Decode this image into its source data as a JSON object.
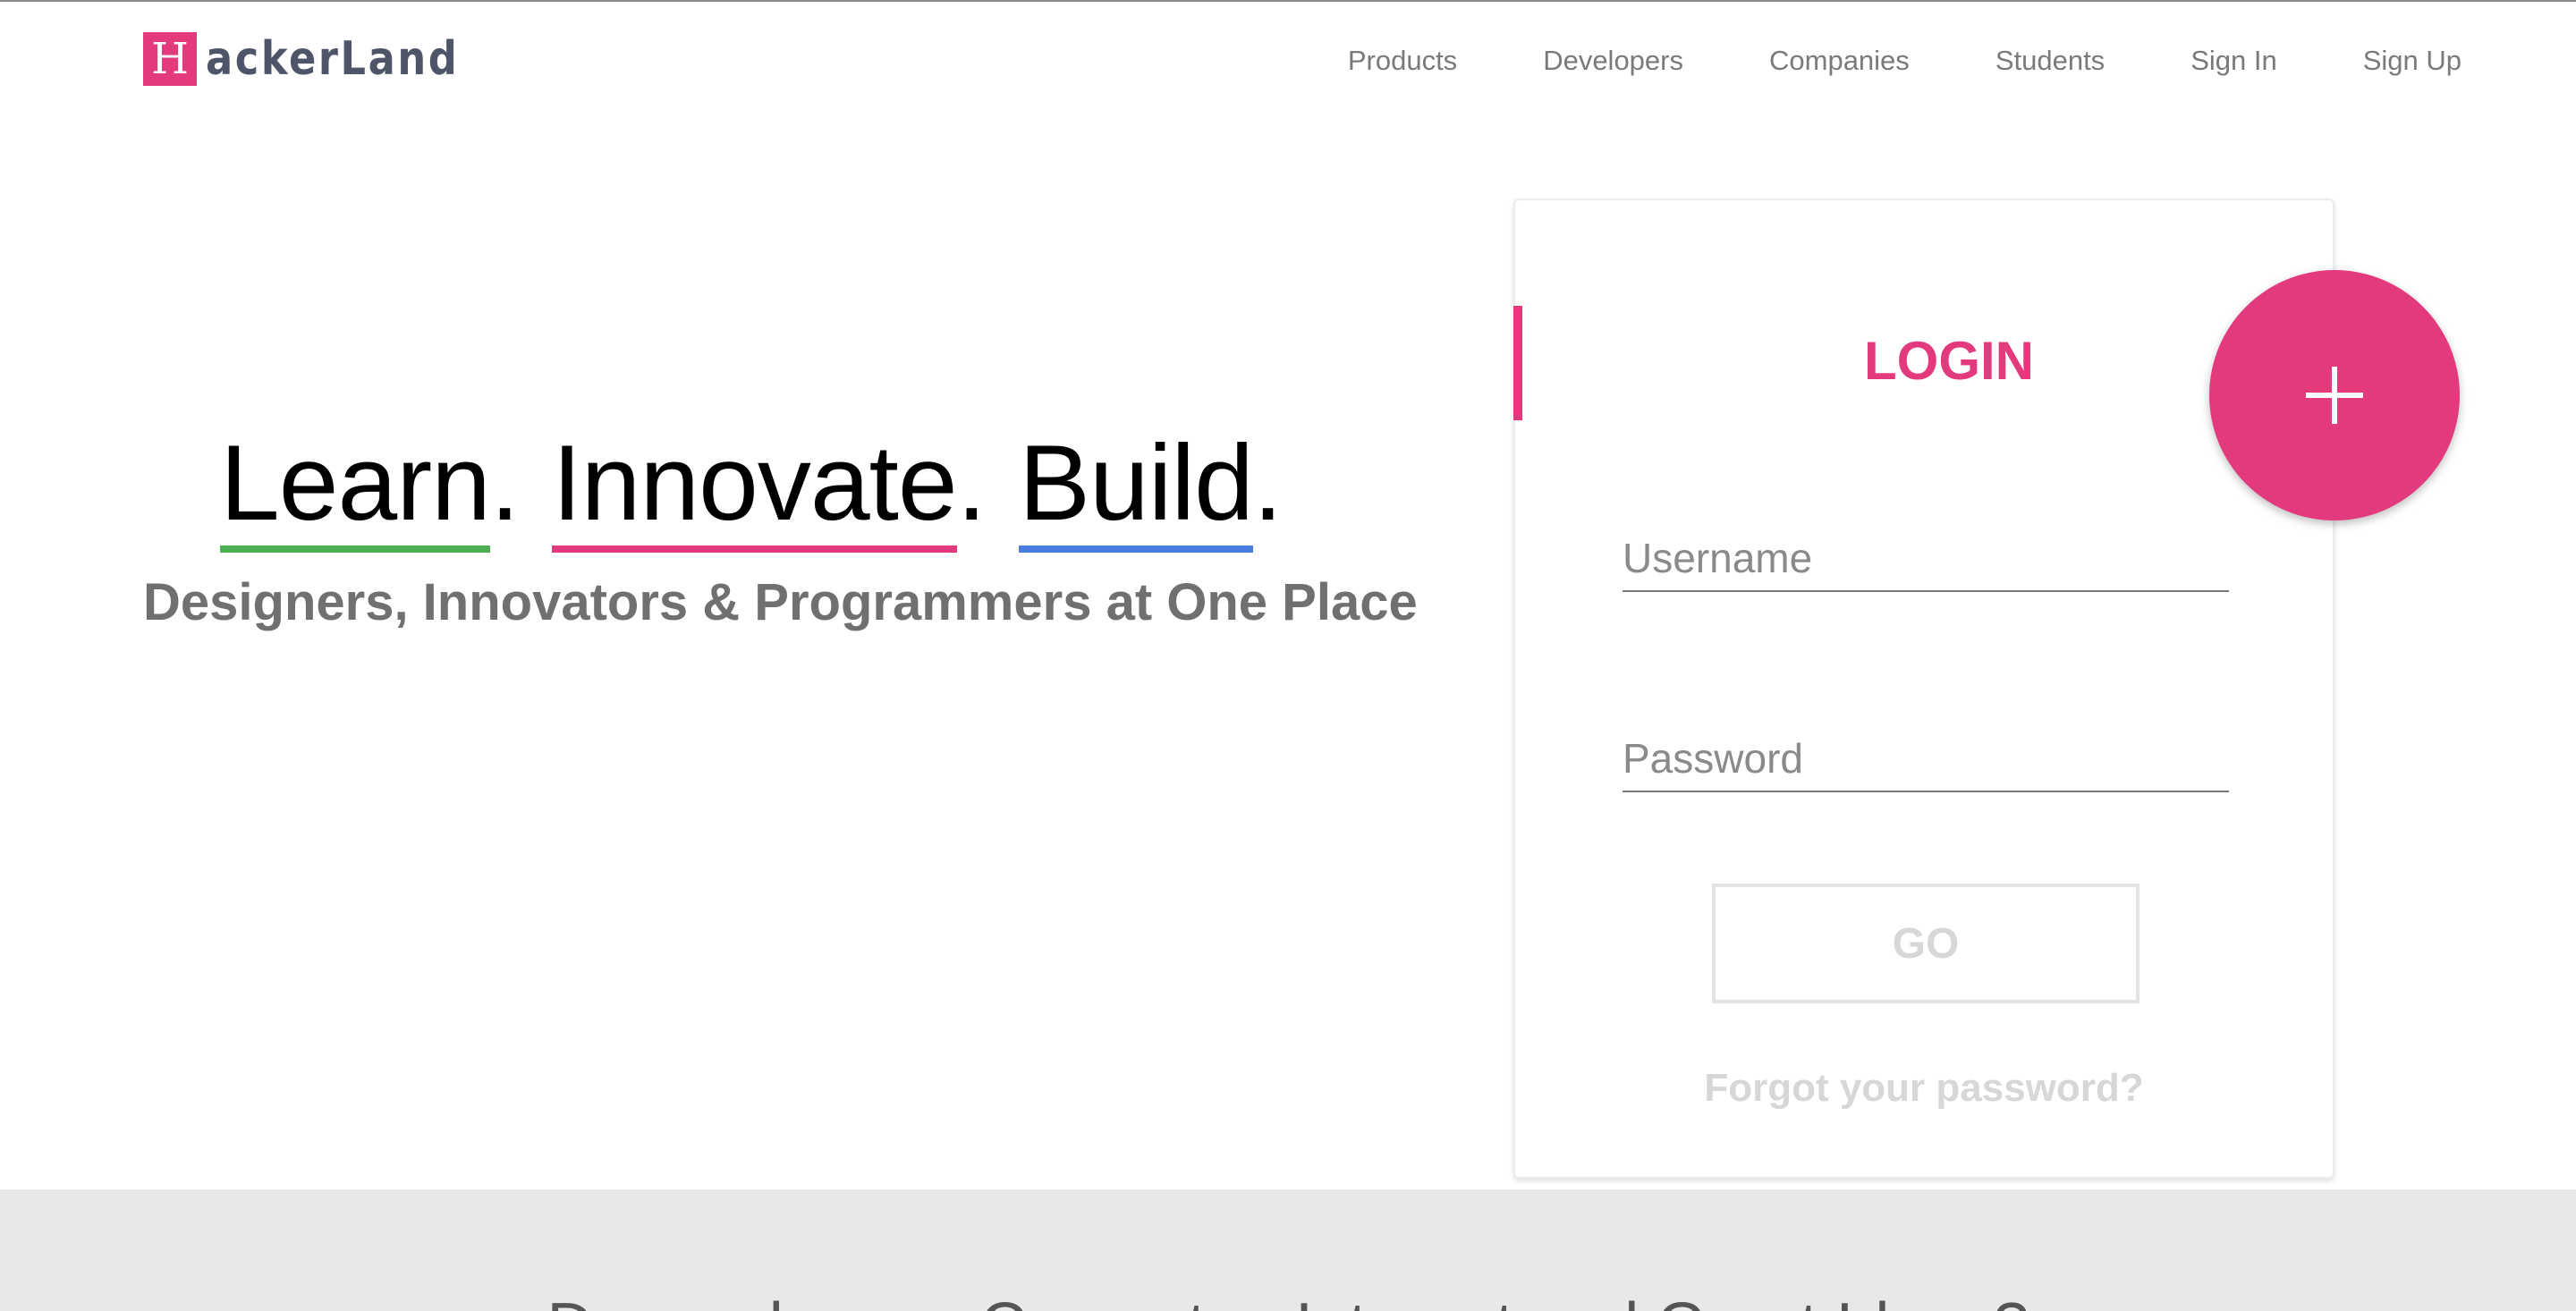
{
  "header": {
    "logo_letter": "H",
    "logo_text": "ackerLand",
    "nav": [
      {
        "label": "Products"
      },
      {
        "label": "Developers"
      },
      {
        "label": "Companies"
      },
      {
        "label": "Students"
      },
      {
        "label": "Sign In"
      },
      {
        "label": "Sign Up"
      }
    ]
  },
  "hero": {
    "words": [
      {
        "text": "Learn",
        "underline_color": "#4caf50"
      },
      {
        "text": "Innovate",
        "underline_color": "#e33a7d"
      },
      {
        "text": "Build",
        "underline_color": "#4a7be0"
      }
    ],
    "punctuation": ".",
    "subtitle": "Designers, Innovators & Programmers at One Place"
  },
  "login": {
    "title": "LOGIN",
    "username_placeholder": "Username",
    "password_placeholder": "Password",
    "go_label": "GO",
    "forgot_label": "Forgot your password?",
    "fab_icon": "plus-icon"
  },
  "bottom_band": {
    "text": "Do you have a Computer, Internet and Great Ideas?"
  },
  "colors": {
    "accent": "#e33a7d",
    "nav_text": "#7a7a7a",
    "subtitle": "#707070",
    "band_background": "#e8e8e8"
  }
}
